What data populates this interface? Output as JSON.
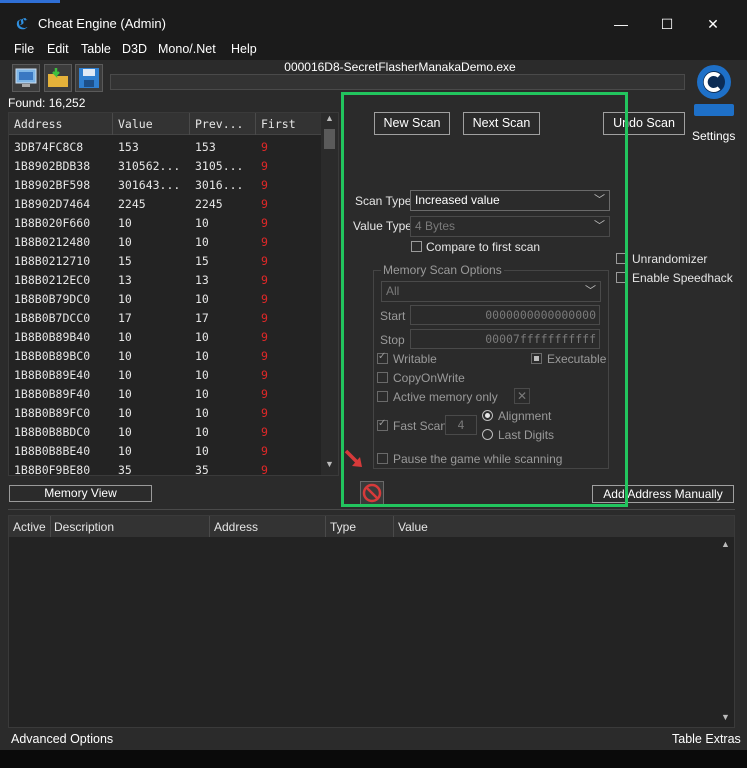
{
  "window": {
    "title": "Cheat Engine (Admin)",
    "minimize": "—",
    "maximize": "☐",
    "close": "✕"
  },
  "menu": [
    "File",
    "Edit",
    "Table",
    "D3D",
    "Mono/.Net",
    "Help"
  ],
  "process_title": "000016D8-SecretFlasherManakaDemo.exe",
  "found_label": "Found: 16,252",
  "settings_label": "Settings",
  "results": {
    "columns": [
      "Address",
      "Value",
      "Prev...",
      "First"
    ],
    "rows": [
      [
        "3DB74FC8C8",
        "153",
        "153",
        "9"
      ],
      [
        "1B8902BDB38",
        "310562...",
        "3105...",
        "9"
      ],
      [
        "1B8902BF598",
        "301643...",
        "3016...",
        "9"
      ],
      [
        "1B8902D7464",
        "2245",
        "2245",
        "9"
      ],
      [
        "1B8B020F660",
        "10",
        "10",
        "9"
      ],
      [
        "1B8B0212480",
        "10",
        "10",
        "9"
      ],
      [
        "1B8B0212710",
        "15",
        "15",
        "9"
      ],
      [
        "1B8B0212EC0",
        "13",
        "13",
        "9"
      ],
      [
        "1B8B0B79DC0",
        "10",
        "10",
        "9"
      ],
      [
        "1B8B0B7DCC0",
        "17",
        "17",
        "9"
      ],
      [
        "1B8B0B89B40",
        "10",
        "10",
        "9"
      ],
      [
        "1B8B0B89BC0",
        "10",
        "10",
        "9"
      ],
      [
        "1B8B0B89E40",
        "10",
        "10",
        "9"
      ],
      [
        "1B8B0B89F40",
        "10",
        "10",
        "9"
      ],
      [
        "1B8B0B89FC0",
        "10",
        "10",
        "9"
      ],
      [
        "1B8B0B8BDC0",
        "10",
        "10",
        "9"
      ],
      [
        "1B8B0B8BE40",
        "10",
        "10",
        "9"
      ],
      [
        "1B8B0F9BE80",
        "35",
        "35",
        "9"
      ]
    ]
  },
  "memory_view_button": "Memory View",
  "scan": {
    "new_scan": "New Scan",
    "next_scan": "Next Scan",
    "undo_scan": "Undo Scan",
    "scan_type_label": "Scan Type",
    "scan_type_value": "Increased value",
    "value_type_label": "Value Type",
    "value_type_value": "4 Bytes",
    "compare_first": "Compare to first scan",
    "unrandomizer": "Unrandomizer",
    "enable_speedhack": "Enable Speedhack",
    "memory_scan_options": "Memory Scan Options",
    "region_value": "All",
    "start_label": "Start",
    "start_value": "0000000000000000",
    "stop_label": "Stop",
    "stop_value": "00007fffffffffff",
    "writable": "Writable",
    "executable": "Executable",
    "copy_on_write": "CopyOnWrite",
    "active_memory_only": "Active memory only",
    "fast_scan": "Fast Scan",
    "fast_scan_value": "4",
    "alignment": "Alignment",
    "last_digits": "Last Digits",
    "pause_game": "Pause the game while scanning",
    "add_address_manually": "Add Address Manually"
  },
  "address_list": {
    "columns": [
      "Active",
      "Description",
      "Address",
      "Type",
      "Value"
    ]
  },
  "status": {
    "advanced_options": "Advanced Options",
    "table_extras": "Table Extras"
  },
  "colors": {
    "highlight_box": "#22c55e",
    "first_value": "#e02828"
  }
}
